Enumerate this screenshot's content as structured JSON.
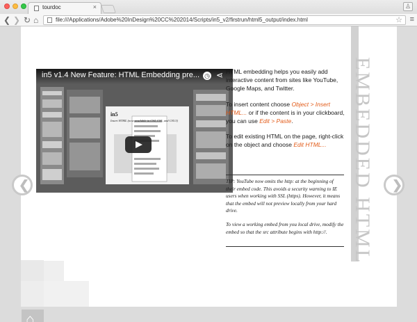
{
  "browser": {
    "tab_title": "tourdoc",
    "tab_close": "×",
    "url": "file:///Applications/Adobe%20InDesign%20CC%202014/Scripts/in5_v2/firstrun/html5_output/index.html",
    "icons": {
      "back": "❮",
      "forward": "❯",
      "reload": "↻",
      "home": "⌂",
      "star": "☆",
      "menu": "≡",
      "profile": "♙"
    }
  },
  "video": {
    "title": "in5 v1.4 New Feature: HTML Embedding pre...",
    "brand": "in5",
    "subtitle": "Insert HTML (now available in CS4, CS5, and CS5.5)",
    "clock_icon": "◷",
    "share_icon": "⋖"
  },
  "content": {
    "p1": "HTML embedding helps you easily add interactive content from sites like YouTube, Google Maps, and Twitter.",
    "p2_before": "To insert content choose ",
    "p2_link1": "Object > Insert HTML...",
    "p2_middle": " or if the content is in your clickboard, you can use ",
    "p2_link2": "Edit > Paste",
    "p2_after": ".",
    "p3_before": "To edit existing HTML on the page, right-click on the object and choose ",
    "p3_link": "Edit HTML...",
    "tip1": "TIP: YouTube now omits the http: at the beginning of their embed code. This avoids a security warning to IE users when working with SSL (https). However, it means that the embed will not preview locally from your hard drive.",
    "tip2": "To view a working embed from you local drive, modify the embed so that the src attribute begins with http://."
  },
  "side_title": "EMBEDDED HTML",
  "nav": {
    "prev_icon": "❮",
    "next_icon": "❯",
    "home_icon": "⌂"
  },
  "colors": {
    "accent": "#e25a17",
    "side_text": "#c6c6c6",
    "nav_circle": "#c9c9c9"
  }
}
